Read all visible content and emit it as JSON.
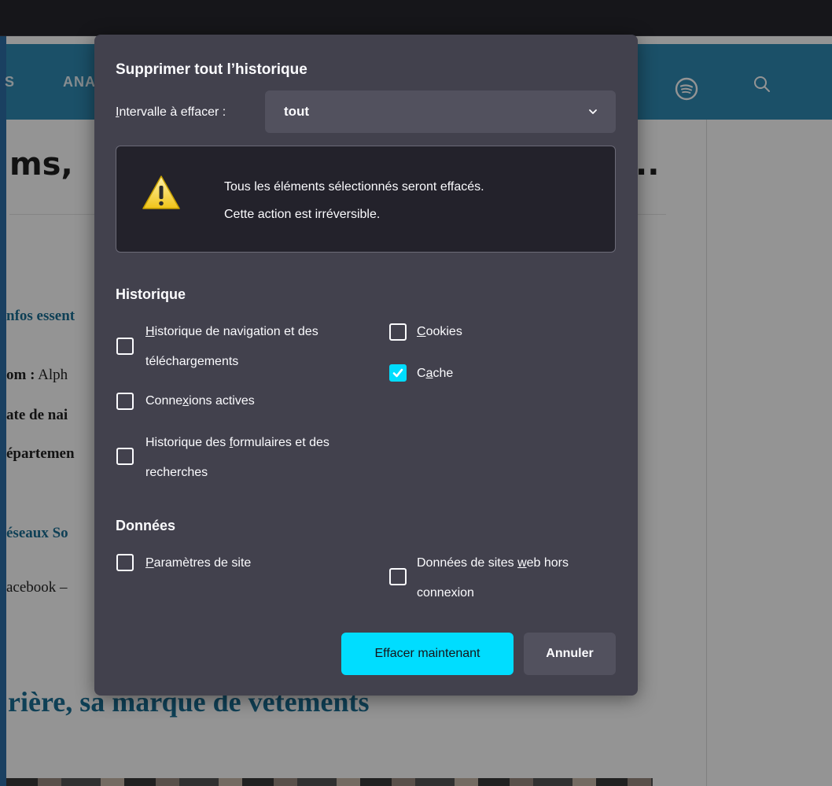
{
  "background": {
    "nav": {
      "left_fragment": "S",
      "item": "ANA"
    },
    "headline": "ms,",
    "headline_trailing": "..",
    "paragraphs": [
      {
        "text": "nfos essent"
      },
      {
        "bold": "om :",
        "text": " Alph"
      },
      {
        "bold": "ate de nai"
      },
      {
        "bold": "épartemen"
      },
      {
        "text": "éseaux So"
      },
      {
        "text": "acebook –"
      }
    ],
    "bottom_heading": "rière, sa marque de vêtements"
  },
  "dialog": {
    "title": "Supprimer tout l’historique",
    "range": {
      "label_accel": "I",
      "label_rest": "ntervalle à effacer :",
      "value": "tout"
    },
    "warning": {
      "line1": "Tous les éléments sélectionnés seront effacés.",
      "line2": "Cette action est irréversible."
    },
    "history": {
      "title": "Historique",
      "navigation": {
        "accel": "H",
        "line1_rest": "istorique de navigation et des",
        "line2": "téléchargements",
        "checked": false
      },
      "active_logins": {
        "pre": "Conne",
        "accel": "x",
        "post": "ions actives",
        "checked": false
      },
      "forms": {
        "line1_pre": "Historique des ",
        "accel": "f",
        "line1_post": "ormulaires et des",
        "line2": "recherches",
        "checked": false
      },
      "cookies": {
        "accel": "C",
        "rest": "ookies",
        "checked": false
      },
      "cache": {
        "pre": "C",
        "accel": "a",
        "post": "che",
        "checked": true
      }
    },
    "data": {
      "title": "Données",
      "site_settings": {
        "accel": "P",
        "rest": "aramètres de site",
        "checked": false
      },
      "offline": {
        "line1_pre": "Données de sites ",
        "accel": "w",
        "line1_post": "eb hors",
        "line2": "connexion",
        "checked": false
      }
    },
    "buttons": {
      "clear_now": "Effacer maintenant",
      "cancel": "Annuler"
    }
  },
  "colors": {
    "dialog_bg": "#42414d",
    "accent": "#00ddff",
    "nav_bg": "#2f8ab3",
    "link_blue": "#1b6f95"
  }
}
